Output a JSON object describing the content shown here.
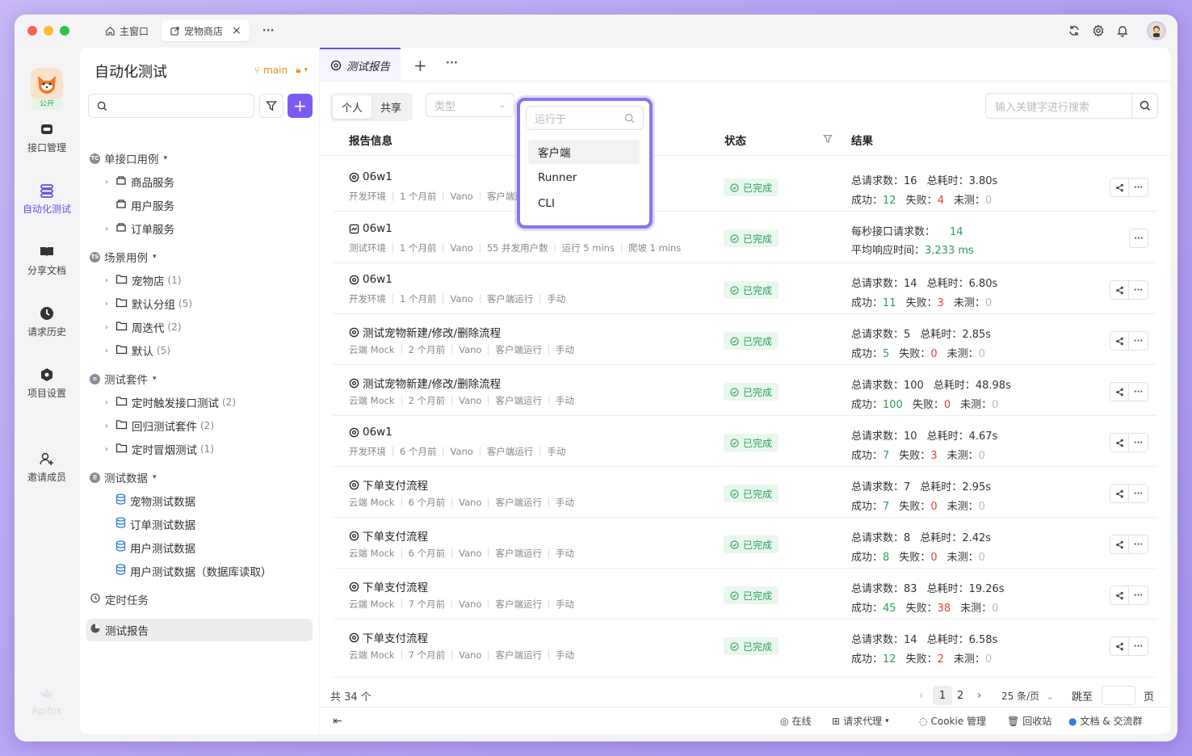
{
  "titlebar": {
    "home_tab": "主窗口",
    "active_tab": "宠物商店",
    "more": "···"
  },
  "rail": [
    {
      "label": "接口管理",
      "icon": "api-icon"
    },
    {
      "label": "自动化测试",
      "icon": "automation-icon"
    },
    {
      "label": "分享文档",
      "icon": "book-icon"
    },
    {
      "label": "请求历史",
      "icon": "clock-icon"
    },
    {
      "label": "项目设置",
      "icon": "settings-icon"
    },
    {
      "label": "邀请成员",
      "icon": "add-user-icon"
    }
  ],
  "project": {
    "badge": "公开",
    "brand": "Apifox"
  },
  "sidebar": {
    "title": "自动化测试",
    "branch": "main",
    "tree": [
      {
        "label": "单接口用例",
        "type": "section",
        "badge": "TC"
      },
      {
        "label": "商品服务",
        "type": "svc",
        "caret": true
      },
      {
        "label": "用户服务",
        "type": "svc",
        "caret": false
      },
      {
        "label": "订单服务",
        "type": "svc",
        "caret": true
      },
      {
        "label": "场景用例",
        "type": "section",
        "badge": "TS"
      },
      {
        "label": "宠物店",
        "type": "folder",
        "count": "(1)"
      },
      {
        "label": "默认分组",
        "type": "folder",
        "count": "(5)"
      },
      {
        "label": "周迭代",
        "type": "folder",
        "count": "(2)"
      },
      {
        "label": "默认",
        "type": "folder",
        "count": "(5)"
      },
      {
        "label": "测试套件",
        "type": "section",
        "badge": "list"
      },
      {
        "label": "定时触发接口测试",
        "type": "folder",
        "count": "(2)"
      },
      {
        "label": "回归测试套件",
        "type": "folder",
        "count": "(2)"
      },
      {
        "label": "定时冒烟测试",
        "type": "folder",
        "count": "(1)"
      },
      {
        "label": "测试数据",
        "type": "section",
        "badge": "db"
      },
      {
        "label": "宠物测试数据",
        "type": "data"
      },
      {
        "label": "订单测试数据",
        "type": "data"
      },
      {
        "label": "用户测试数据",
        "type": "data"
      },
      {
        "label": "用户测试数据（数据库读取）",
        "type": "data"
      },
      {
        "label": "定时任务",
        "type": "plain"
      },
      {
        "label": "测试报告",
        "type": "active"
      }
    ]
  },
  "main": {
    "tab": "测试报告",
    "seg": [
      "个人",
      "共享"
    ],
    "type_placeholder": "类型",
    "run_placeholder": "运行于",
    "search_placeholder": "输入关键字进行搜索",
    "headers": {
      "info": "报告信息",
      "status": "状态",
      "result": "结果"
    },
    "dropdown": [
      "客户端",
      "Runner",
      "CLI"
    ],
    "rows": [
      {
        "title": "06w1",
        "meta": [
          "开发环境",
          "1 个月前",
          "Vano",
          "客户端运"
        ],
        "status": "已完成",
        "kind": "normal",
        "total": "16",
        "time": "3.80s",
        "ok": "12",
        "fail": "4",
        "skip": "0",
        "share": true
      },
      {
        "title": "06w1",
        "meta": [
          "测试环境",
          "1 个月前",
          "Vano",
          "55 并发用户数",
          "运行 5 mins",
          "爬坡 1 mins"
        ],
        "status": "已完成",
        "kind": "perf",
        "qps": "14",
        "avg": "3,233 ms",
        "share": false
      },
      {
        "title": "06w1",
        "meta": [
          "开发环境",
          "1 个月前",
          "Vano",
          "客户端运行",
          "手动"
        ],
        "status": "已完成",
        "kind": "normal",
        "total": "14",
        "time": "6.80s",
        "ok": "11",
        "fail": "3",
        "skip": "0",
        "share": true
      },
      {
        "title": "测试宠物新建/修改/删除流程",
        "meta": [
          "云端 Mock",
          "2 个月前",
          "Vano",
          "客户端运行",
          "手动"
        ],
        "status": "已完成",
        "kind": "normal",
        "total": "5",
        "time": "2.85s",
        "ok": "5",
        "fail": "0",
        "skip": "0",
        "share": true
      },
      {
        "title": "测试宠物新建/修改/删除流程",
        "meta": [
          "云端 Mock",
          "2 个月前",
          "Vano",
          "客户端运行",
          "手动"
        ],
        "status": "已完成",
        "kind": "normal",
        "total": "100",
        "time": "48.98s",
        "ok": "100",
        "fail": "0",
        "skip": "0",
        "share": true
      },
      {
        "title": "06w1",
        "meta": [
          "开发环境",
          "6 个月前",
          "Vano",
          "客户端运行",
          "手动"
        ],
        "status": "已完成",
        "kind": "normal",
        "total": "10",
        "time": "4.67s",
        "ok": "7",
        "fail": "3",
        "skip": "0",
        "share": true
      },
      {
        "title": "下单支付流程",
        "meta": [
          "云端 Mock",
          "6 个月前",
          "Vano",
          "客户端运行",
          "手动"
        ],
        "status": "已完成",
        "kind": "normal",
        "total": "7",
        "time": "2.95s",
        "ok": "7",
        "fail": "0",
        "skip": "0",
        "share": true
      },
      {
        "title": "下单支付流程",
        "meta": [
          "云端 Mock",
          "6 个月前",
          "Vano",
          "客户端运行",
          "手动"
        ],
        "status": "已完成",
        "kind": "normal",
        "total": "8",
        "time": "2.42s",
        "ok": "8",
        "fail": "0",
        "skip": "0",
        "share": true
      },
      {
        "title": "下单支付流程",
        "meta": [
          "云端 Mock",
          "7 个月前",
          "Vano",
          "客户端运行",
          "手动"
        ],
        "status": "已完成",
        "kind": "normal",
        "total": "83",
        "time": "19.26s",
        "ok": "45",
        "fail": "38",
        "skip": "0",
        "share": true
      },
      {
        "title": "下单支付流程",
        "meta": [
          "云端 Mock",
          "7 个月前",
          "Vano",
          "客户端运行",
          "手动"
        ],
        "status": "已完成",
        "kind": "normal",
        "total": "14",
        "time": "6.58s",
        "ok": "12",
        "fail": "2",
        "skip": "0",
        "share": true
      }
    ],
    "labels": {
      "total": "总请求数：",
      "time": "总耗时：",
      "ok": "成功：",
      "fail": "失败：",
      "skip": "未测：",
      "qps": "每秒接口请求数：",
      "avg": "平均响应时间："
    },
    "pager": {
      "total": "共 34 个",
      "pages": [
        "1",
        "2"
      ],
      "size": "25 条/页",
      "jump": "跳至",
      "page_unit": "页"
    },
    "bottom": [
      "在线",
      "请求代理",
      "Cookie 管理",
      "回收站",
      "文档 & 交流群"
    ]
  },
  "colors": {
    "accent": "#6a4ce6",
    "success": "#2aa35a",
    "fail": "#e5433b",
    "branch": "#e88a1a"
  }
}
